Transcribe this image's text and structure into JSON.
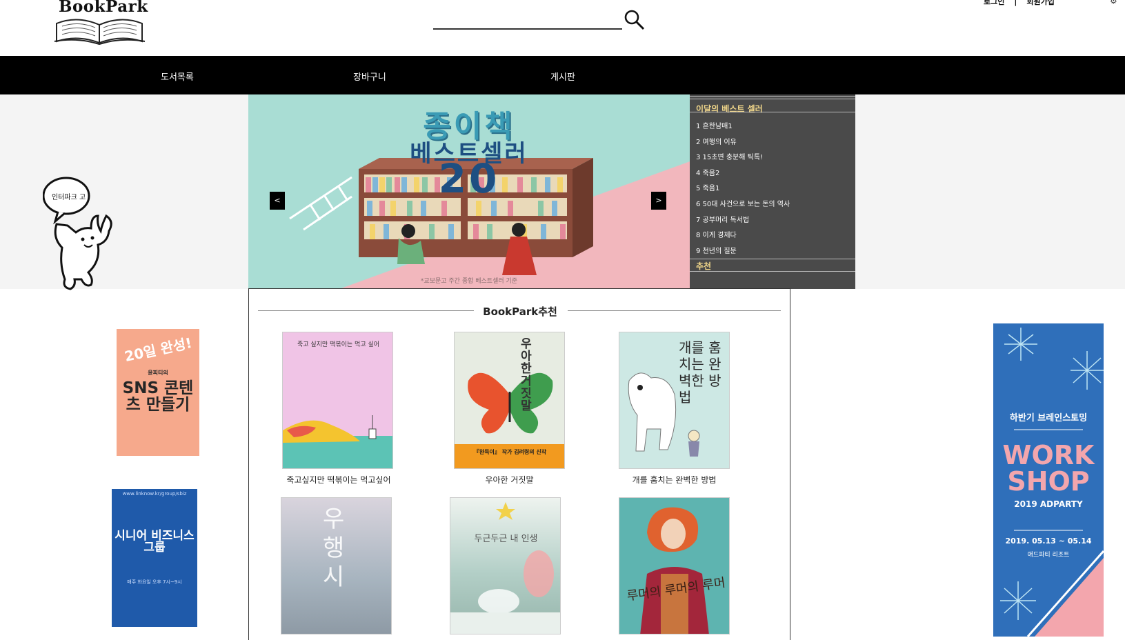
{
  "header": {
    "logo_text": "BookPark",
    "search_placeholder": "",
    "login_label": "로그인",
    "separator": "|",
    "signup_label": "회원가입"
  },
  "nav": {
    "items": [
      {
        "label": "도서목록"
      },
      {
        "label": "장바구니"
      },
      {
        "label": "게시판"
      }
    ]
  },
  "mascot": {
    "bubble_text": "인터파크 고"
  },
  "banner": {
    "title_line1": "종이책",
    "title_line2": "베스트셀러",
    "title_line3": "20",
    "footnote": "*교보문고 주간 종합 베스트셀러 기준",
    "prev_label": "<",
    "next_label": ">"
  },
  "bestseller": {
    "title": "이달의 베스트 셀러",
    "items": [
      "1 흔한남매1",
      "2 여행의 이유",
      "3 15초면 충분해 틱톡!",
      "4 죽음2",
      "5 죽음1",
      "6 50대 사건으로 보는 돈의 역사",
      "7 공부머리 독서법",
      "8 이게 경제다",
      "9 천년의 질문"
    ],
    "recommend_label": "추천"
  },
  "ads": {
    "left_top": {
      "line1": "20일 완성!",
      "line2": "윤피티의",
      "line3": "SNS 콘텐츠 만들기"
    },
    "left_bottom": {
      "url": "www.linknow.kr/group/sbiz",
      "title": "시니어 비즈니스 그룹",
      "subtitle": "매주 화요일 오후 7시~9시"
    },
    "right": {
      "line1": "하반기 브레인스토밍",
      "line2": "WORK SHOP",
      "line3": "2019 ADPARTY",
      "dates": "2019. 05.13 ~ 05.14",
      "venue": "애드파티 리조트"
    }
  },
  "recommend": {
    "title": "BookPark추천",
    "books": [
      {
        "caption": "죽고싶지만 떡볶이는 먹고싶어",
        "cover_text": "죽고 싶지만 떡볶이는 먹고 싶어"
      },
      {
        "caption": "우아한 거짓말",
        "cover_text": "우아한 거짓말",
        "cover_band": "『완득이』 작가 김려령의 신작"
      },
      {
        "caption": "개를 훔치는 완벽한 방법",
        "cover_text": "개를 훔치는 완벽한 방법"
      },
      {
        "caption": "",
        "cover_text": "우행시"
      },
      {
        "caption": "",
        "cover_text": "두근두근 내 인생"
      },
      {
        "caption": "",
        "cover_text": "루머의 루머의 루머"
      }
    ]
  },
  "colors": {
    "nav_bg": "#000000",
    "panel_bg": "#4a4a4a",
    "panel_heading": "#f0d68a",
    "hero_band": "#f4f4f4"
  }
}
